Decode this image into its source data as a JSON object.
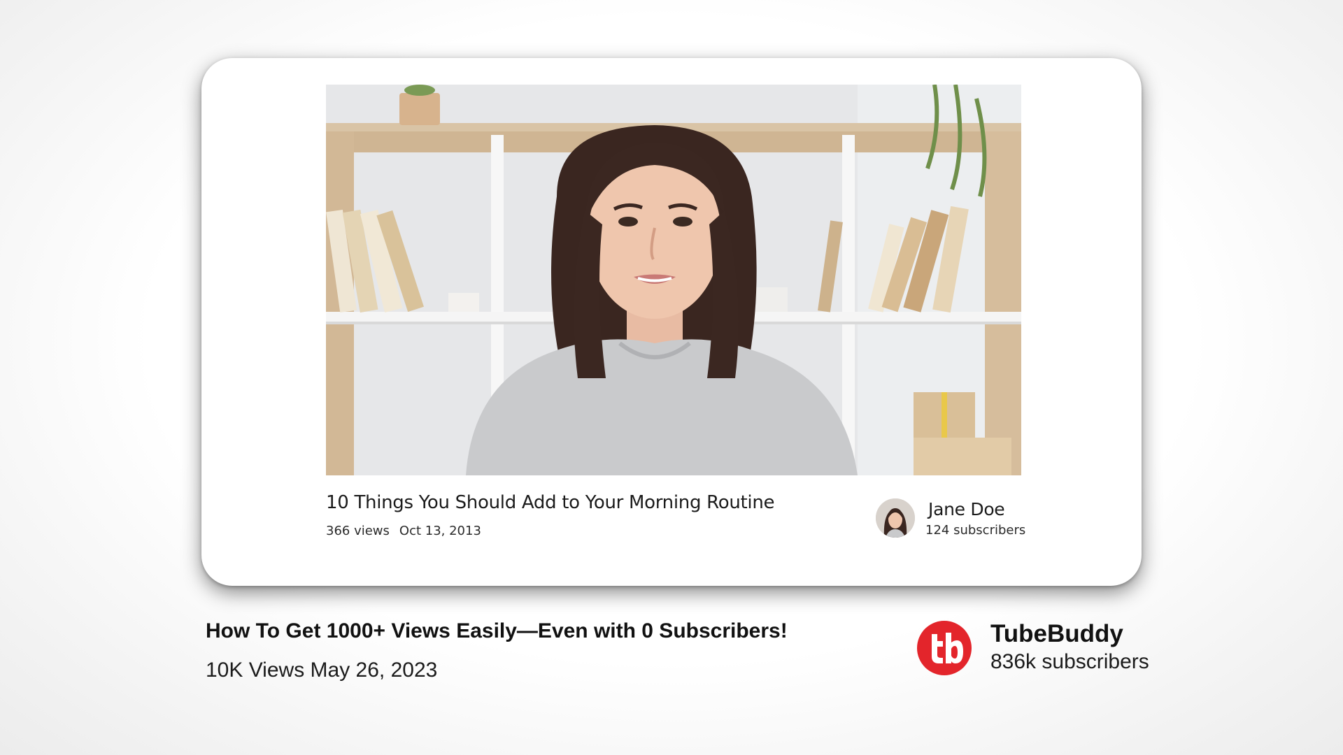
{
  "featured_video": {
    "title": "10 Things You Should Add to Your Morning Routine",
    "views": "366 views",
    "date": "Oct 13, 2013",
    "channel_name": "Jane Doe",
    "subscribers": "124 subscribers"
  },
  "main_video": {
    "title": "How To Get 1000+ Views Easily—Even with 0 Subscribers!",
    "views_date": "10K Views May 26, 2023",
    "channel_name": "TubeBuddy",
    "subscribers": "836k subscribers"
  },
  "icons": {
    "channel_logo": "tubebuddy-logo-icon",
    "avatar": "avatar-icon"
  },
  "colors": {
    "brand_red": "#e3252b",
    "card_background": "#ffffff",
    "text_dark": "#111111"
  }
}
